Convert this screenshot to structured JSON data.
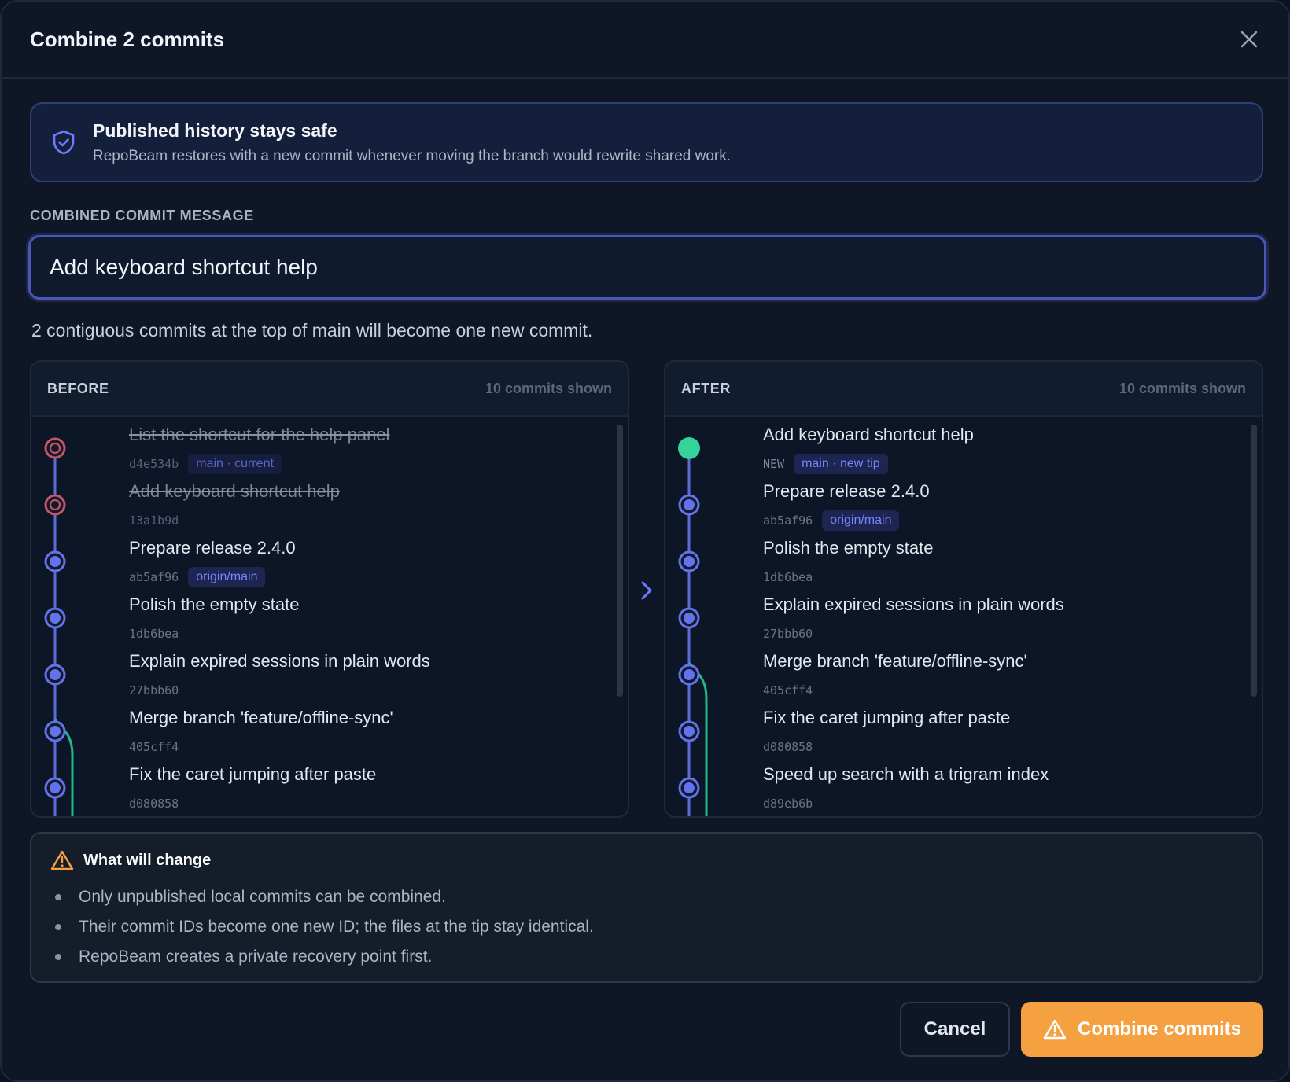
{
  "dialog": {
    "title": "Combine 2 commits",
    "close_icon": "close-icon"
  },
  "banner": {
    "icon": "shield-check-icon",
    "title": "Published history stays safe",
    "text": "RepoBeam restores with a new commit whenever moving the branch would rewrite shared work."
  },
  "message": {
    "label": "COMBINED COMMIT MESSAGE",
    "value": "Add keyboard shortcut help"
  },
  "summary": "2 contiguous commits at the top of main will become one new commit.",
  "before": {
    "title": "BEFORE",
    "count": "10 commits shown",
    "rows": [
      {
        "message": "List the shortcut for the help panel",
        "sha": "d4e534b",
        "tag": "main · current",
        "removed": true
      },
      {
        "message": "Add keyboard shortcut help",
        "sha": "13a1b9d",
        "tag": "",
        "removed": true
      },
      {
        "message": "Prepare release 2.4.0",
        "sha": "ab5af96",
        "tag": "origin/main",
        "removed": false
      },
      {
        "message": "Polish the empty state",
        "sha": "1db6bea",
        "tag": "",
        "removed": false
      },
      {
        "message": "Explain expired sessions in plain words",
        "sha": "27bbb60",
        "tag": "",
        "removed": false
      },
      {
        "message": "Merge branch 'feature/offline-sync'",
        "sha": "405cff4",
        "tag": "",
        "removed": false
      },
      {
        "message": "Fix the caret jumping after paste",
        "sha": "d080858",
        "tag": "",
        "removed": false
      }
    ]
  },
  "after": {
    "title": "AFTER",
    "count": "10 commits shown",
    "rows": [
      {
        "message": "Add keyboard shortcut help",
        "sha": "NEW",
        "tag": "main · new tip",
        "new": true
      },
      {
        "message": "Prepare release 2.4.0",
        "sha": "ab5af96",
        "tag": "origin/main"
      },
      {
        "message": "Polish the empty state",
        "sha": "1db6bea",
        "tag": ""
      },
      {
        "message": "Explain expired sessions in plain words",
        "sha": "27bbb60",
        "tag": ""
      },
      {
        "message": "Merge branch 'feature/offline-sync'",
        "sha": "405cff4",
        "tag": ""
      },
      {
        "message": "Fix the caret jumping after paste",
        "sha": "d080858",
        "tag": ""
      },
      {
        "message": "Speed up search with a trigram index",
        "sha": "d89eb6b",
        "tag": ""
      }
    ]
  },
  "arrow_icon": "chevron-right-icon",
  "warning": {
    "icon": "warning-triangle-icon",
    "title": "What will change",
    "items": [
      "Only unpublished local commits can be combined.",
      "Their commit IDs become one new ID; the files at the tip stay identical.",
      "RepoBeam creates a private recovery point first."
    ]
  },
  "actions": {
    "cancel": "Cancel",
    "combine": "Combine commits"
  },
  "colors": {
    "accent": "#f5a041",
    "node_blue": "#6373f0",
    "node_removed": "#c2566a",
    "node_new": "#34d399",
    "merge_line": "#22b989"
  }
}
